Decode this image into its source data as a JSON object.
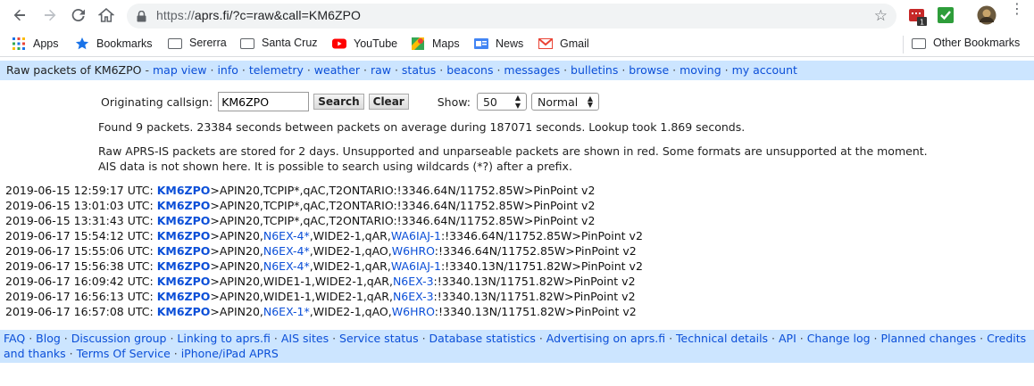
{
  "browser": {
    "url_scheme": "https://",
    "url_rest": "aprs.fi/?c=raw&call=KM6ZPO",
    "ext_badge": "1"
  },
  "bookmarks": {
    "items": [
      "Apps",
      "Bookmarks",
      "Sererra",
      "Santa Cruz",
      "YouTube",
      "Maps",
      "News",
      "Gmail"
    ],
    "other": "Other Bookmarks"
  },
  "nav": {
    "title": "Raw packets of KM6ZPO",
    "links": [
      "map view",
      "info",
      "telemetry",
      "weather",
      "raw",
      "status",
      "beacons",
      "messages",
      "bulletins",
      "browse",
      "moving",
      "my account"
    ]
  },
  "form": {
    "callsign_label": "Originating callsign:",
    "callsign_value": "KM6ZPO",
    "search_label": "Search",
    "clear_label": "Clear",
    "show_label": "Show:",
    "show_value": "50",
    "mode_value": "Normal"
  },
  "info": {
    "found": "Found 9 packets. 23384 seconds between packets on average during 187071 seconds. Lookup took 1.869 seconds.",
    "note": "Raw APRS-IS packets are stored for 2 days. Unsupported and unparseable packets are shown in red. Some formats are unsupported at the moment. AIS data is not shown here. It is possible to search using wildcards (*?) after a prefix."
  },
  "packets": [
    {
      "ts": "2019-06-15 12:59:17 UTC:",
      "call": "KM6ZPO",
      "parts": [
        [
          ">APIN20,TCPIP*,qAC,T2ONTARIO:!3346.64N/11752.85W>PinPoint v2",
          false
        ]
      ]
    },
    {
      "ts": "2019-06-15 13:01:03 UTC:",
      "call": "KM6ZPO",
      "parts": [
        [
          ">APIN20,TCPIP*,qAC,T2ONTARIO:!3346.64N/11752.85W>PinPoint v2",
          false
        ]
      ]
    },
    {
      "ts": "2019-06-15 13:31:43 UTC:",
      "call": "KM6ZPO",
      "parts": [
        [
          ">APIN20,TCPIP*,qAC,T2ONTARIO:!3346.64N/11752.85W>PinPoint v2",
          false
        ]
      ]
    },
    {
      "ts": "2019-06-17 15:54:12 UTC:",
      "call": "KM6ZPO",
      "parts": [
        [
          ">APIN20,",
          false
        ],
        [
          "N6EX-4*",
          true
        ],
        [
          ",WIDE2-1,qAR,",
          false
        ],
        [
          "WA6IAJ-1",
          true
        ],
        [
          ":!3346.64N/11752.85W>PinPoint v2",
          false
        ]
      ]
    },
    {
      "ts": "2019-06-17 15:55:06 UTC:",
      "call": "KM6ZPO",
      "parts": [
        [
          ">APIN20,",
          false
        ],
        [
          "N6EX-4*",
          true
        ],
        [
          ",WIDE2-1,qAO,",
          false
        ],
        [
          "W6HRO",
          true
        ],
        [
          ":!3346.64N/11752.85W>PinPoint v2",
          false
        ]
      ]
    },
    {
      "ts": "2019-06-17 15:56:38 UTC:",
      "call": "KM6ZPO",
      "parts": [
        [
          ">APIN20,",
          false
        ],
        [
          "N6EX-4*",
          true
        ],
        [
          ",WIDE2-1,qAR,",
          false
        ],
        [
          "WA6IAJ-1",
          true
        ],
        [
          ":!3340.13N/11751.82W>PinPoint v2",
          false
        ]
      ]
    },
    {
      "ts": "2019-06-17 16:09:42 UTC:",
      "call": "KM6ZPO",
      "parts": [
        [
          ">APIN20,WIDE1-1,WIDE2-1,qAR,",
          false
        ],
        [
          "N6EX-3",
          true
        ],
        [
          ":!3340.13N/11751.82W>PinPoint v2",
          false
        ]
      ]
    },
    {
      "ts": "2019-06-17 16:56:13 UTC:",
      "call": "KM6ZPO",
      "parts": [
        [
          ">APIN20,WIDE1-1,WIDE2-1,qAR,",
          false
        ],
        [
          "N6EX-3",
          true
        ],
        [
          ":!3340.13N/11751.82W>PinPoint v2",
          false
        ]
      ]
    },
    {
      "ts": "2019-06-17 16:57:08 UTC:",
      "call": "KM6ZPO",
      "parts": [
        [
          ">APIN20,",
          false
        ],
        [
          "N6EX-1*",
          true
        ],
        [
          ",WIDE2-1,qAO,",
          false
        ],
        [
          "W6HRO",
          true
        ],
        [
          ":!3340.13N/11751.82W>PinPoint v2",
          false
        ]
      ]
    }
  ],
  "footer": {
    "links": [
      "FAQ",
      "Blog",
      "Discussion group",
      "Linking to aprs.fi",
      "AIS sites",
      "Service status",
      "Database statistics",
      "Advertising on aprs.fi",
      "Technical details",
      "API",
      "Change log",
      "Planned changes",
      "Credits and thanks",
      "Terms Of Service",
      "iPhone/iPad APRS"
    ]
  },
  "colors": {
    "link": "#0b4fd8",
    "bar": "#cce5ff"
  }
}
